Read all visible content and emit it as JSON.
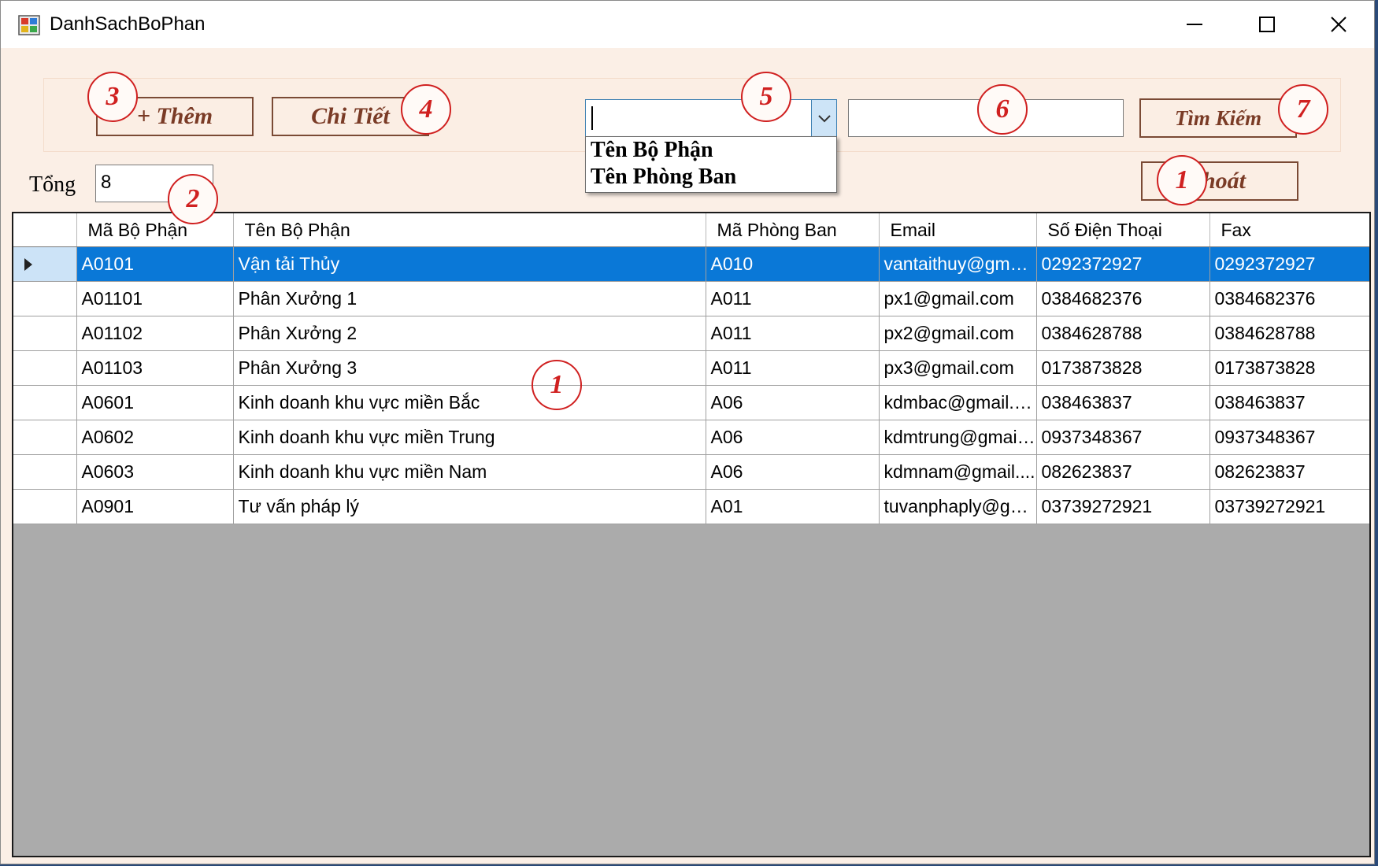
{
  "window": {
    "title": "DanhSachBoPhan"
  },
  "toolbar": {
    "add_label": "+ Thêm",
    "detail_label": "Chi Tiết",
    "search_label": "Tìm Kiếm",
    "exit_label": "hoát",
    "combo_value": "",
    "search_text": ""
  },
  "dropdown": {
    "options": [
      "Tên Bộ Phận",
      "Tên Phòng Ban"
    ]
  },
  "total": {
    "label": "Tổng",
    "value": "8"
  },
  "grid": {
    "columns": [
      "Mã Bộ Phận",
      "Tên Bộ Phận",
      "Mã Phòng Ban",
      "Email",
      "Số Điện Thoại",
      "Fax"
    ],
    "rows": [
      [
        "A0101",
        "Vận tải Thủy",
        "A010",
        "vantaithuy@gmai...",
        "0292372927",
        "0292372927"
      ],
      [
        "A01101",
        "Phân Xưởng 1",
        "A011",
        "px1@gmail.com",
        "0384682376",
        "0384682376"
      ],
      [
        "A01102",
        "Phân Xưởng 2",
        "A011",
        "px2@gmail.com",
        "0384628788",
        "0384628788"
      ],
      [
        "A01103",
        "Phân Xưởng 3",
        "A011",
        "px3@gmail.com",
        "0173873828",
        "0173873828"
      ],
      [
        "A0601",
        "Kinh doanh khu vực miền Bắc",
        "A06",
        "kdmbac@gmail.c...",
        "038463837",
        "038463837"
      ],
      [
        "A0602",
        "Kinh doanh khu vực miền Trung",
        "A06",
        "kdmtrung@gmail....",
        "0937348367",
        "0937348367"
      ],
      [
        "A0603",
        "Kinh doanh khu vực miền Nam",
        "A06",
        "kdmnam@gmail....",
        "082623837",
        "082623837"
      ],
      [
        "A0901",
        "Tư vấn pháp lý",
        "A01",
        "tuvanphaply@gm...",
        "03739272921",
        "03739272921"
      ]
    ],
    "selected_row": 0
  },
  "annotations": {
    "add": "3",
    "detail": "4",
    "combo": "5",
    "search_input": "6",
    "search_button": "7",
    "exit": "1",
    "total": "2",
    "grid": "1"
  },
  "colors": {
    "form_bg": "#fbefe6",
    "selection": "#0a78d7",
    "grid_empty": "#ababab",
    "annotation": "#d02020",
    "button_text": "#7a3b26"
  },
  "icons": {
    "app": "app-icon",
    "minimize": "minimize-icon",
    "maximize": "maximize-icon",
    "close": "close-icon",
    "combo_arrow": "chevron-down-icon",
    "row_pointer": "row-pointer-icon"
  }
}
